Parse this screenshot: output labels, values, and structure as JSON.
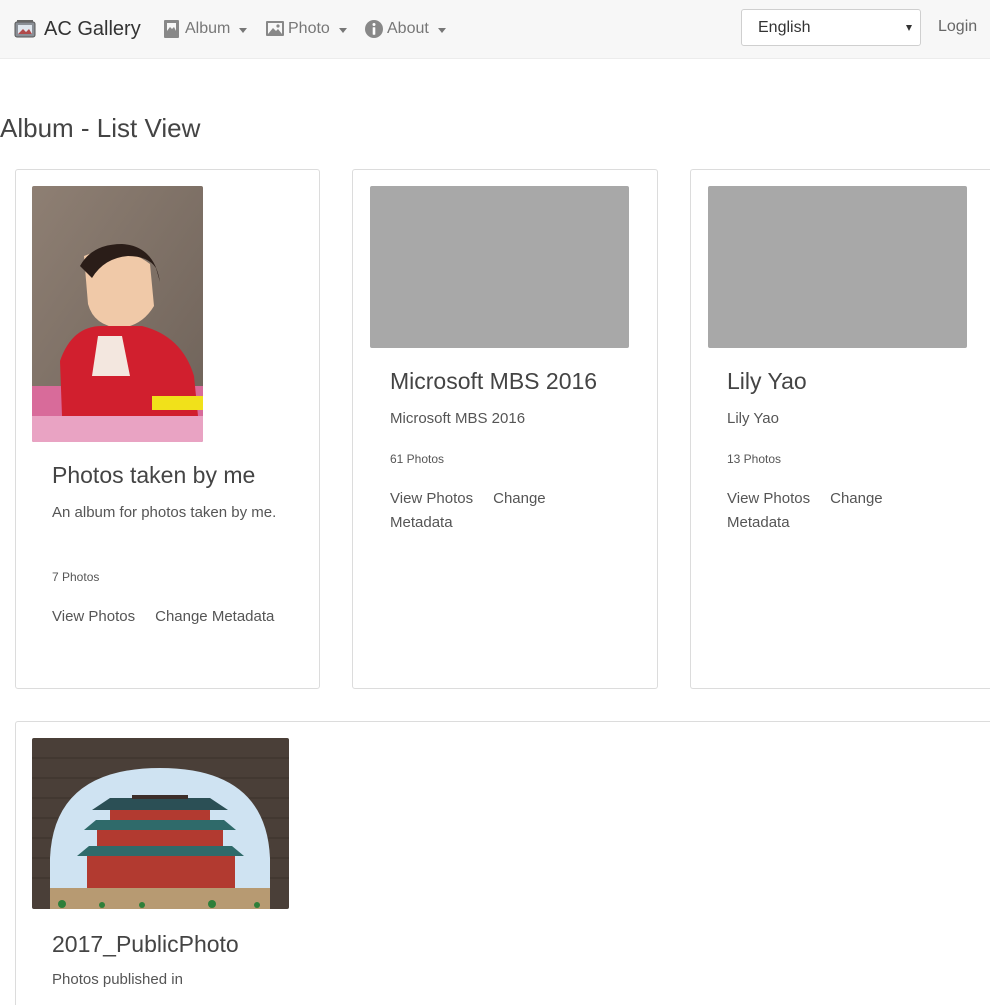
{
  "navbar": {
    "brand": "AC Gallery",
    "brand_icon": "gallery-icon",
    "menus": [
      {
        "label": "Album",
        "icon": "album-icon"
      },
      {
        "label": "Photo",
        "icon": "image-icon"
      },
      {
        "label": "About",
        "icon": "info-icon"
      }
    ],
    "language": "English",
    "login": "Login"
  },
  "page": {
    "title": "Album - List View"
  },
  "albums": [
    {
      "title": "Photos taken by me",
      "description": "An album for photos taken by me.",
      "count": "7 Photos",
      "view_label": "View Photos",
      "change_label": "Change Metadata"
    },
    {
      "title": "Microsoft MBS 2016",
      "description": "Microsoft MBS 2016",
      "count": "61 Photos",
      "view_label": "View Photos",
      "change_label": "Change Metadata"
    },
    {
      "title": "Lily Yao",
      "description": "Lily Yao",
      "count": "13 Photos",
      "view_label": "View Photos",
      "change_label": "Change Metadata"
    },
    {
      "title": "2017_PublicPhoto",
      "description": "Photos published in"
    }
  ],
  "colors": {
    "navbar_bg": "#f7f7f7",
    "placeholder_gray": "#a8a8a8",
    "text": "#555555"
  }
}
